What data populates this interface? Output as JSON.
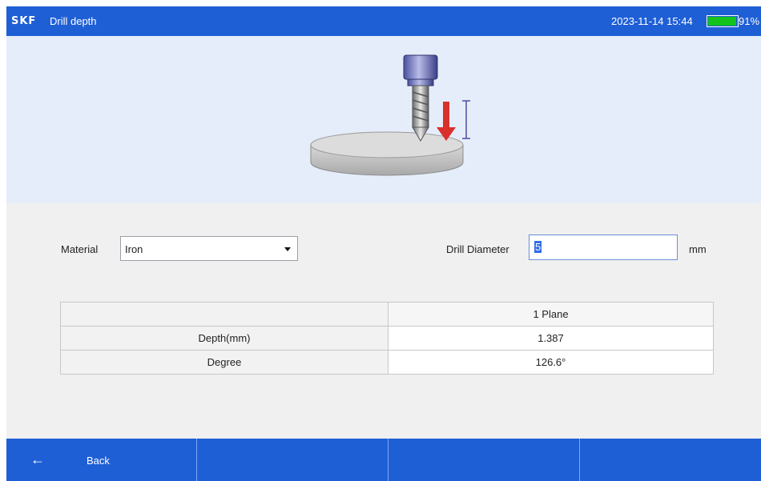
{
  "header": {
    "brand": "SKF",
    "title": "Drill depth",
    "datetime": "2023-11-14 15:44",
    "battery_percent": "91%",
    "battery_level": 0.91,
    "battery_color": "#14c21c",
    "bar_color": "#1f5fd6"
  },
  "illustration": {
    "icon": "drill-plate-icon",
    "arrow_color": "#d9302b"
  },
  "form": {
    "material_label": "Material",
    "material_value": "Iron",
    "diameter_label": "Drill Diameter",
    "diameter_value": "5",
    "diameter_unit": "mm"
  },
  "table": {
    "header": [
      "",
      "1 Plane"
    ],
    "rows": [
      {
        "label": "Depth(mm)",
        "value": "1.387"
      },
      {
        "label": "Degree",
        "value": "126.6°"
      }
    ]
  },
  "footer": {
    "back_icon": "arrow-left-icon",
    "back_label": "Back"
  }
}
